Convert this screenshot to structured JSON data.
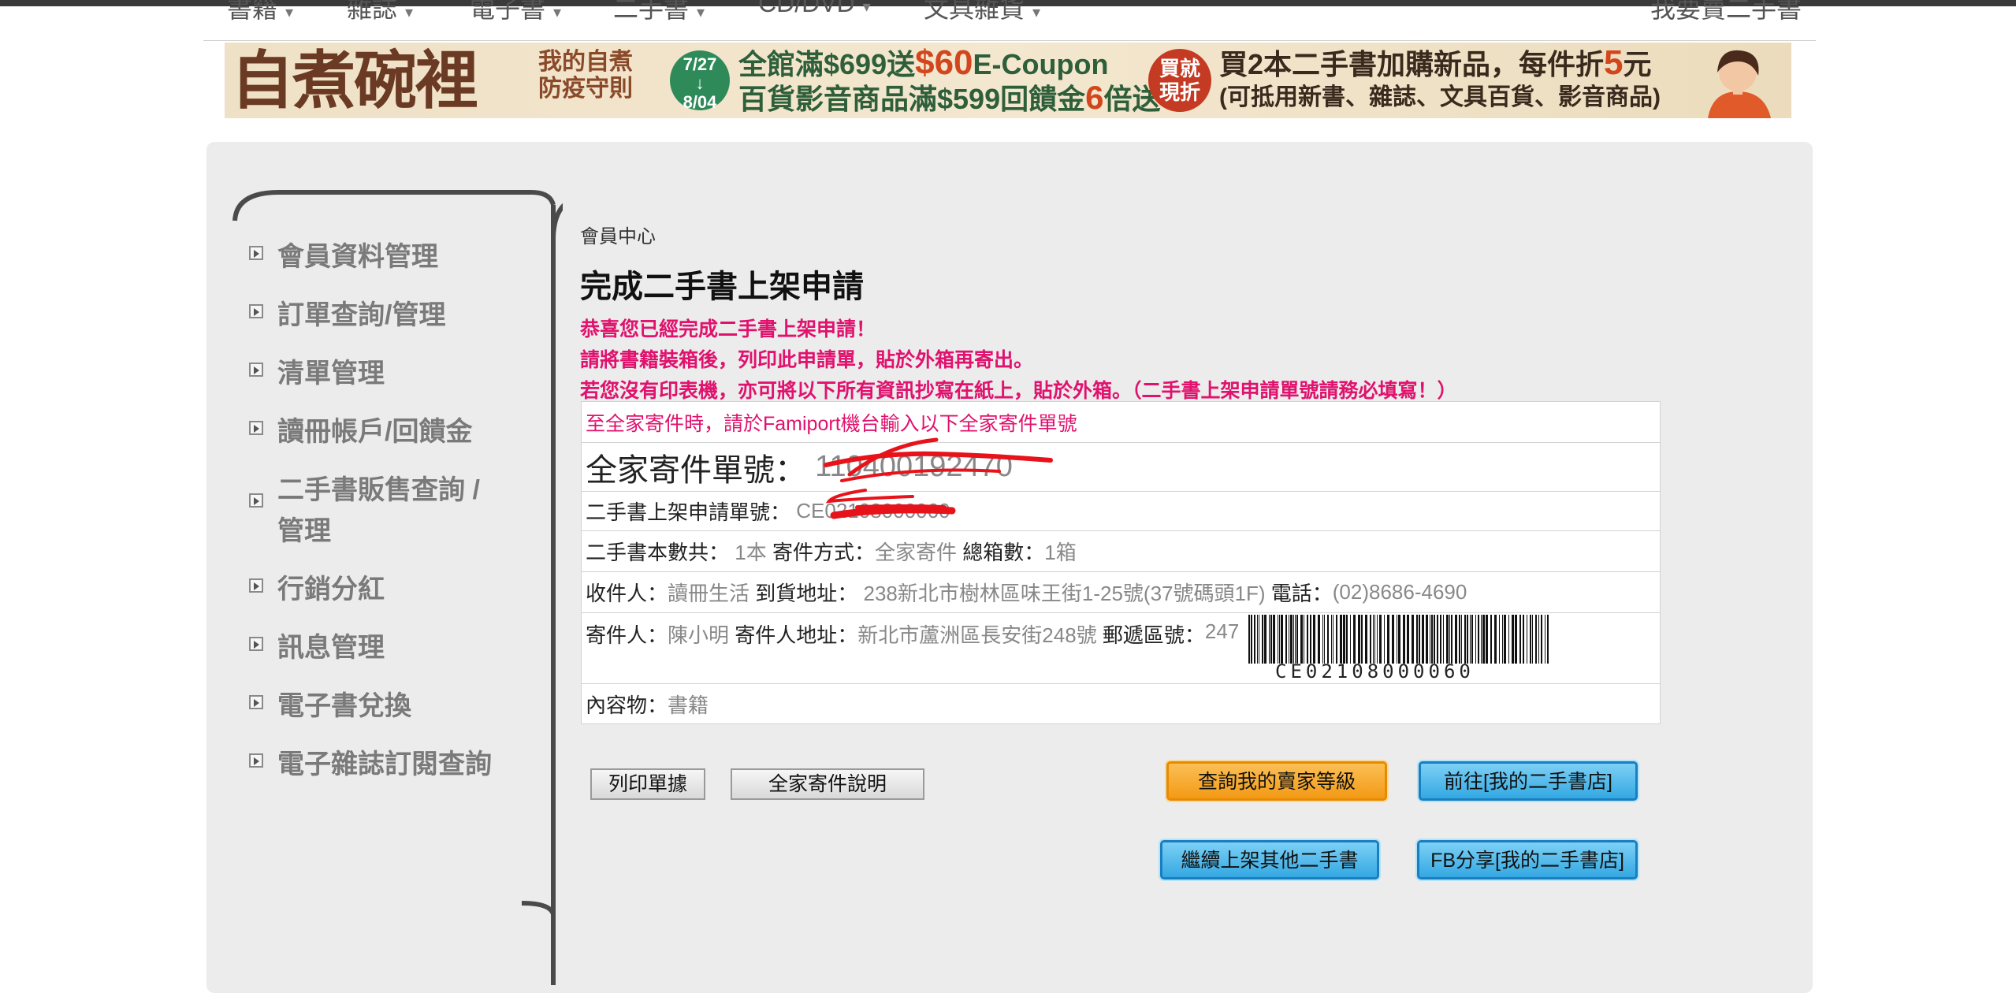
{
  "nav": {
    "items": [
      "書籍",
      "雜誌",
      "電子書",
      "二手書",
      "CD/DVD",
      "文具雜貨"
    ],
    "right": "我要賣二手書"
  },
  "banner": {
    "title": "自煮碗裡",
    "subtitle_line1": "我的自煮",
    "subtitle_line2": "防疫守則",
    "date_from": "7/27",
    "date_to": "8/04",
    "promo1_pre": "全館滿$699送",
    "promo1_em": "$60",
    "promo1_post": "E-Coupon",
    "promo2_pre": "百貨影音商品滿$599回饋金",
    "promo2_em": "6",
    "promo2_post": "倍送",
    "badge_line1": "買就",
    "badge_line2": "現折",
    "promo3_pre": "買2本二手書加購新品，每件折",
    "promo3_em": "5",
    "promo3_post": "元",
    "promo4": "(可抵用新書、雜誌、文具百貨、影音商品)"
  },
  "sidebar": {
    "items": [
      {
        "label": "會員資料管理"
      },
      {
        "label": "訂單查詢/管理"
      },
      {
        "label": "清單管理"
      },
      {
        "label": "讀冊帳戶/回饋金"
      },
      {
        "label": "二手書販售查詢 / 管理"
      },
      {
        "label": "行銷分紅"
      },
      {
        "label": "訊息管理"
      },
      {
        "label": "電子書兌換"
      },
      {
        "label": "電子雜誌訂閱查詢"
      }
    ]
  },
  "main": {
    "breadcrumb": "會員中心",
    "title": "完成二手書上架申請",
    "notice1": "恭喜您已經完成二手書上架申請！",
    "notice2": "請將書籍裝箱後，列印此申請單，貼於外箱再寄出。",
    "notice3": "若您沒有印表機，亦可將以下所有資訊抄寫在紙上，貼於外箱。（二手書上架申請單號請務必填寫！）"
  },
  "info": {
    "famiport_note": "至全家寄件時，請於Famiport機台輸入以下全家寄件單號",
    "ship_no_label": "全家寄件單號：",
    "ship_no_value": "110400192470",
    "apply_no_label": "二手書上架申請單號：",
    "apply_no_value": "CE02108000060",
    "count_label": "二手書本數共：",
    "count_value": "1本",
    "method_label": "寄件方式：",
    "method_value": "全家寄件",
    "boxes_label": "總箱數：",
    "boxes_value": "1箱",
    "recipient_label": "收件人：",
    "recipient_value": "讀冊生活",
    "delivery_label": "到貨地址：",
    "delivery_value": "238新北市樹林區味王街1-25號(37號碼頭1F)",
    "phone_label": "電話：",
    "phone_value": "(02)8686-4690",
    "sender_label": "寄件人：",
    "sender_value": "陳小明",
    "sender_addr_label": "寄件人地址：",
    "sender_addr_value": "新北市蘆洲區長安街248號",
    "zip_label": "郵遞區號：",
    "zip_value": "247",
    "barcode_text": "CE02108000060",
    "contents_label": "內容物：",
    "contents_value": "書籍"
  },
  "buttons": {
    "print": "列印單據",
    "family_help": "全家寄件說明",
    "seller_level": "查詢我的賣家等級",
    "go_store": "前往[我的二手書店]",
    "continue": "繼續上架其他二手書",
    "fb_share": "FB分享[我的二手書店]"
  },
  "colors": {
    "notice_pink": "#e0126e",
    "panel_bg": "#ececec",
    "orange_button": "#f39a16",
    "blue_button": "#34a8e2",
    "redaction_red": "#e8121a"
  }
}
